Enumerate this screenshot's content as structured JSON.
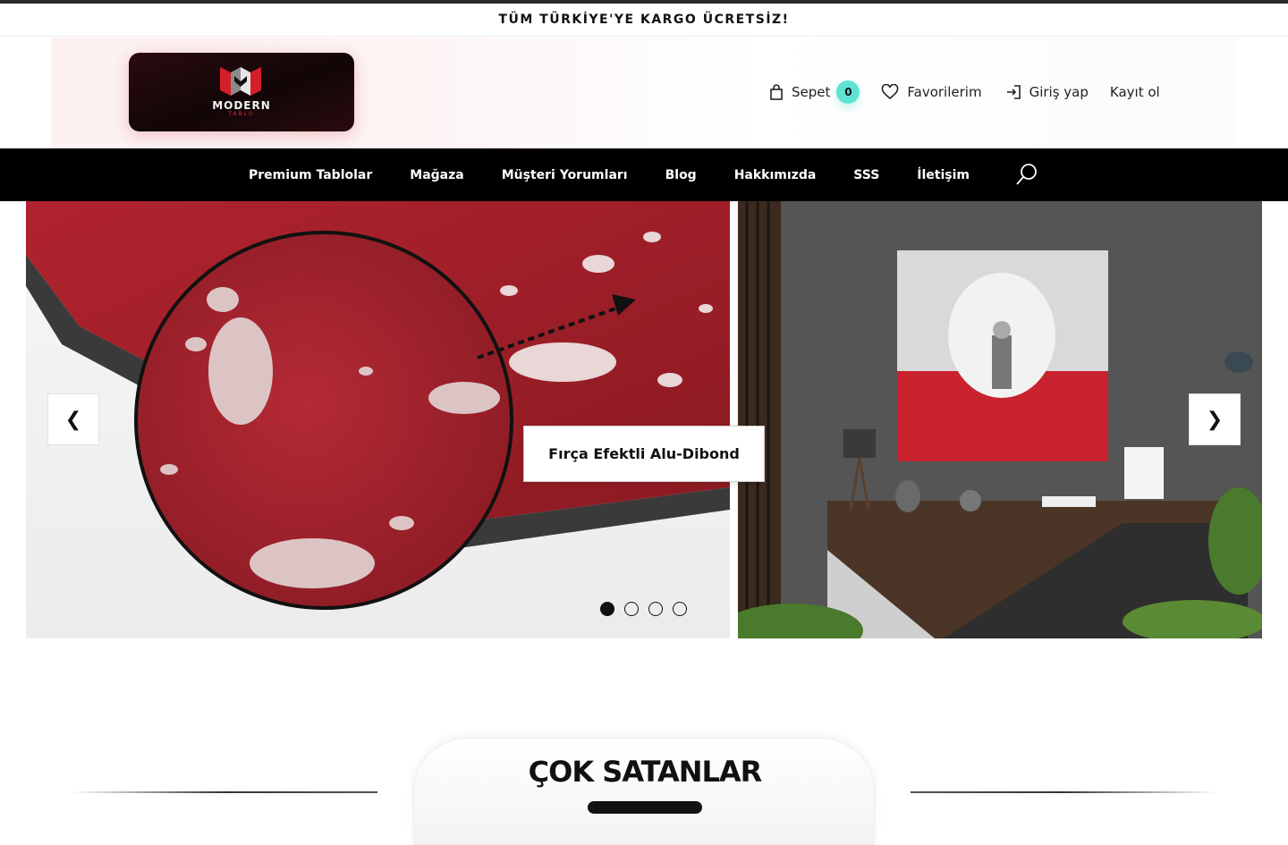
{
  "announcement": {
    "text": "TÜM TÜRKİYE'YE KARGO ÜCRETSİZ!"
  },
  "logo": {
    "word": "MODERN",
    "sub": "TABLO"
  },
  "user_nav": {
    "cart_label": "Sepet",
    "cart_count": "0",
    "favorites_label": "Favorilerim",
    "login_label": "Giriş yap",
    "register_label": "Kayıt ol"
  },
  "main_nav": {
    "items": [
      {
        "label": "Premium Tablolar"
      },
      {
        "label": "Mağaza"
      },
      {
        "label": "Müşteri Yorumları"
      },
      {
        "label": "Blog"
      },
      {
        "label": "Hakkımızda"
      },
      {
        "label": "SSS"
      },
      {
        "label": "İletişim"
      }
    ]
  },
  "slider": {
    "caption": "Fırça Efektli Alu-Dibond",
    "prev_label": "❮",
    "next_label": "❯",
    "slide_count": 4,
    "active_slide": 1
  },
  "section": {
    "title": "ÇOK SATANLAR"
  },
  "colors": {
    "accent": "#5fe2d2",
    "nav_bg": "#000000",
    "brand_red": "#d2323c"
  }
}
